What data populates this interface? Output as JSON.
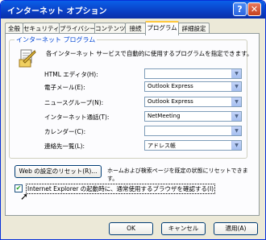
{
  "window": {
    "title": "インターネット オプション",
    "help_icon": "?",
    "close_icon": "✕"
  },
  "tabs": [
    {
      "label": "全般"
    },
    {
      "label": "セキュリティ"
    },
    {
      "label": "プライバシー"
    },
    {
      "label": "コンテンツ"
    },
    {
      "label": "接続"
    },
    {
      "label": "プログラム"
    },
    {
      "label": "詳細設定"
    }
  ],
  "active_tab": "プログラム",
  "group": {
    "legend": "インターネット プログラム",
    "description": "各インターネット サービスで自動的に使用するプログラムを指定できます。",
    "rows": [
      {
        "label": "HTML エディタ(H):",
        "value": ""
      },
      {
        "label": "電子メール(E):",
        "value": "Outlook Express"
      },
      {
        "label": "ニュースグループ(N):",
        "value": "Outlook Express"
      },
      {
        "label": "インターネット通話(T):",
        "value": "NetMeeting"
      },
      {
        "label": "カレンダー(C):",
        "value": ""
      },
      {
        "label": "連絡先一覧(L):",
        "value": "アドレス帳"
      }
    ]
  },
  "reset": {
    "button_label": "Web の設定のリセット(R)...",
    "description": "ホームおよび検索ページを既定の状態にリセットできます。"
  },
  "check_default_browser": {
    "label": "Internet Explorer の起動時に、通常使用するブラウザを確認する(I)",
    "checked": true
  },
  "footer": {
    "ok": "OK",
    "cancel": "キャンセル",
    "apply": "適用(A)"
  },
  "colors": {
    "titlebar": "#0a3fc4",
    "face": "#ece9d8",
    "accent": "#0046d5"
  }
}
